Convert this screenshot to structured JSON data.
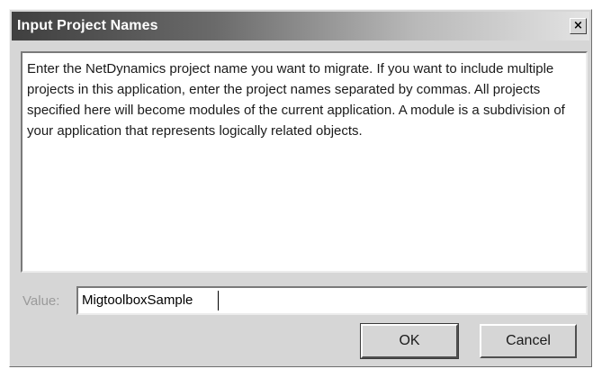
{
  "dialog": {
    "title": "Input Project Names",
    "close_icon": "×"
  },
  "message": "Enter the NetDynamics project name you want to migrate.  If you want to include multiple projects in this application, enter the project names separated by commas.  All projects specified here will become modules of the current application.  A module is a subdivision of your application that represents logically related objects.",
  "value_field": {
    "label": "Value:",
    "value": "MigtoolboxSample"
  },
  "buttons": {
    "ok": "OK",
    "cancel": "Cancel"
  }
}
